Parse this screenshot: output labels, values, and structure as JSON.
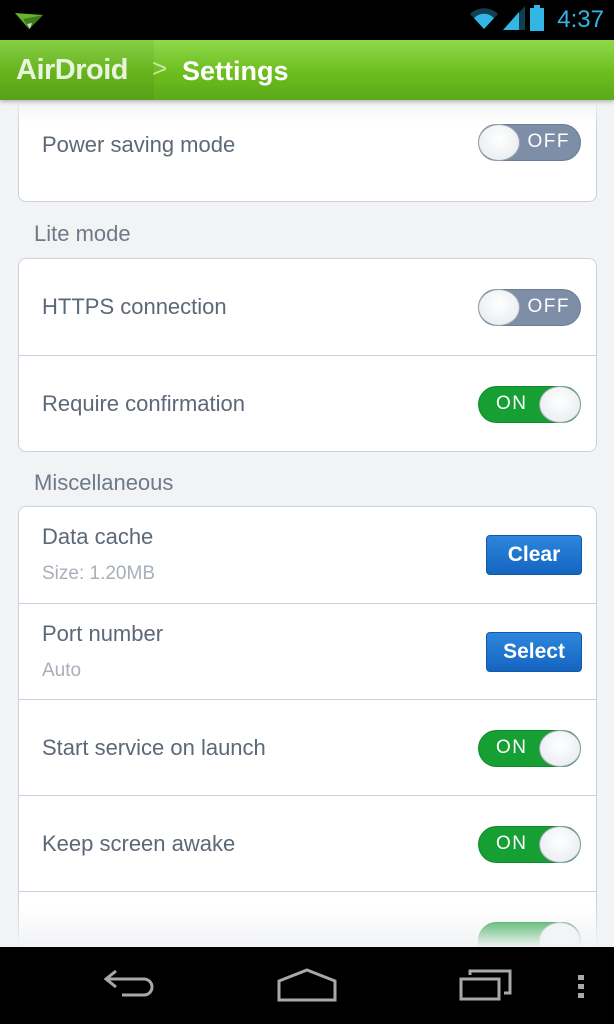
{
  "status_bar": {
    "notification_icon": "airdroid-paper-plane-icon",
    "wifi_icon": "wifi-icon",
    "signal_icon": "cell-signal-icon",
    "battery_icon": "battery-icon",
    "time": "4:37"
  },
  "action_bar": {
    "app_name": "AirDroid",
    "separator": ">",
    "title": "Settings",
    "accent_color": "#6cbd1f"
  },
  "sections": [
    {
      "label": "",
      "items": [
        {
          "title": "Power saving mode",
          "control": "toggle",
          "state": "OFF"
        }
      ]
    },
    {
      "label": "Lite mode",
      "items": [
        {
          "title": "HTTPS connection",
          "control": "toggle",
          "state": "OFF"
        },
        {
          "title": "Require confirmation",
          "control": "toggle",
          "state": "ON"
        }
      ]
    },
    {
      "label": "Miscellaneous",
      "items": [
        {
          "title": "Data cache",
          "subtitle": "Size: 1.20MB",
          "control": "button",
          "button_label": "Clear"
        },
        {
          "title": "Port number",
          "subtitle": "Auto",
          "control": "button",
          "button_label": "Select"
        },
        {
          "title": "Start service on launch",
          "control": "toggle",
          "state": "ON"
        },
        {
          "title": "Keep screen awake",
          "control": "toggle",
          "state": "ON"
        },
        {
          "title": "",
          "control": "toggle",
          "state": "ON"
        }
      ]
    }
  ],
  "colors": {
    "toggle_on": "#16a034",
    "toggle_off": "#7d8ea6",
    "button_blue": "#1e74d0"
  },
  "nav_bar": {
    "back": "back-icon",
    "home": "home-icon",
    "recents": "recent-apps-icon",
    "menu": "overflow-menu-icon"
  }
}
